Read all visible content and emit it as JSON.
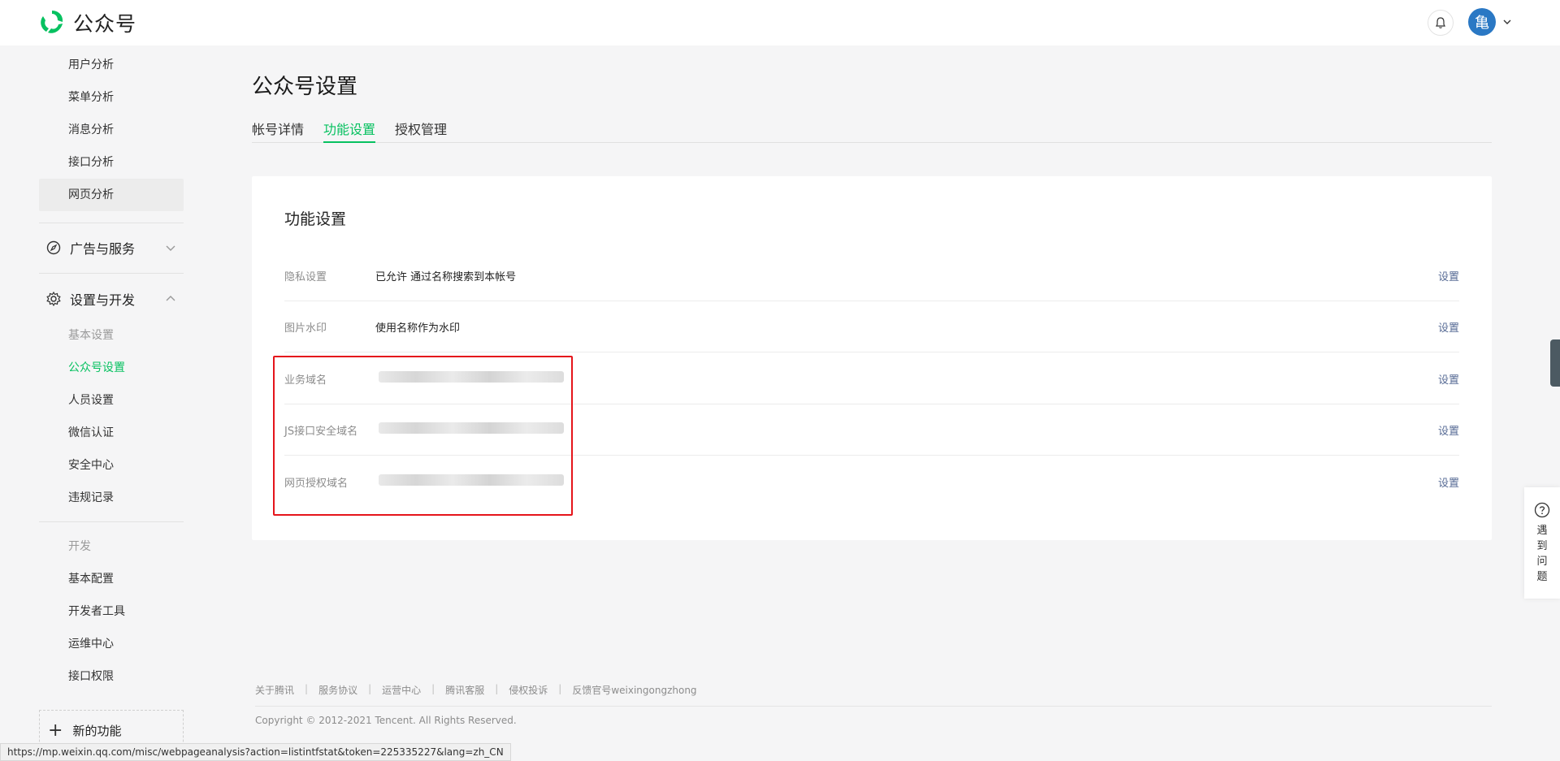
{
  "header": {
    "brand": "公众号",
    "avatar_char": "亀"
  },
  "sidebar": {
    "analysis_items": [
      {
        "label": "用户分析"
      },
      {
        "label": "菜单分析"
      },
      {
        "label": "消息分析"
      },
      {
        "label": "接口分析"
      },
      {
        "label": "网页分析"
      }
    ],
    "group_ads": "广告与服务",
    "group_settings": "设置与开发",
    "basic_header": "基本设置",
    "basic_items": [
      {
        "label": "公众号设置"
      },
      {
        "label": "人员设置"
      },
      {
        "label": "微信认证"
      },
      {
        "label": "安全中心"
      },
      {
        "label": "违规记录"
      }
    ],
    "dev_header": "开发",
    "dev_items": [
      {
        "label": "基本配置"
      },
      {
        "label": "开发者工具"
      },
      {
        "label": "运维中心"
      },
      {
        "label": "接口权限"
      }
    ],
    "new_function": "新的功能"
  },
  "main": {
    "title": "公众号设置",
    "tabs": [
      {
        "label": "帐号详情"
      },
      {
        "label": "功能设置"
      },
      {
        "label": "授权管理"
      }
    ],
    "card_title": "功能设置",
    "rows": [
      {
        "label": "隐私设置",
        "value": "已允许 通过名称搜索到本帐号",
        "action": "设置"
      },
      {
        "label": "图片水印",
        "value": "使用名称作为水印",
        "action": "设置"
      },
      {
        "label": "业务域名",
        "value": "",
        "action": "设置"
      },
      {
        "label": "JS接口安全域名",
        "value": "",
        "action": "设置"
      },
      {
        "label": "网页授权域名",
        "value": "",
        "action": "设置"
      }
    ]
  },
  "footer": {
    "links": [
      "关于腾讯",
      "服务协议",
      "运营中心",
      "腾讯客服",
      "侵权投诉",
      "反馈官号weixingongzhong"
    ],
    "copyright": "Copyright © 2012-2021 Tencent. All Rights Reserved."
  },
  "statusbar_url": "https://mp.weixin.qq.com/misc/webpageanalysis?action=listintfstat&token=225335227&lang=zh_CN",
  "help_text": "遇到问题",
  "colors": {
    "accent": "#07c160",
    "link": "#576b95",
    "highlight": "#e5151b"
  }
}
